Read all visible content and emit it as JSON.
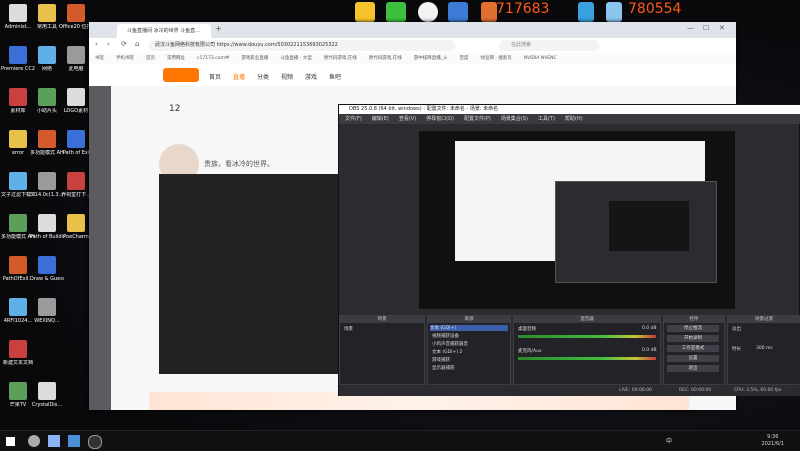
{
  "desktop": {
    "icons": [
      {
        "label": "Administ...",
        "col": 0,
        "row": 0
      },
      {
        "label": "常用工具",
        "col": 1,
        "row": 0
      },
      {
        "label": "Office20 位打印环",
        "col": 2,
        "row": 0
      },
      {
        "label": "Premiere CC2019",
        "col": 0,
        "row": 1
      },
      {
        "label": "网络",
        "col": 1,
        "row": 1
      },
      {
        "label": "此电脑",
        "col": 2,
        "row": 1
      },
      {
        "label": "素材库",
        "col": 0,
        "row": 2
      },
      {
        "label": "小助片头",
        "col": 1,
        "row": 2
      },
      {
        "label": "LOGO素材",
        "col": 2,
        "row": 2
      },
      {
        "label": "error",
        "col": 0,
        "row": 3
      },
      {
        "label": "多功能模式 AHK",
        "col": 1,
        "row": 3
      },
      {
        "label": "Path of Exi",
        "col": 2,
        "row": 3
      },
      {
        "label": "文子过滤下载 地址",
        "col": 0,
        "row": 4
      },
      {
        "label": "3.14.0c(1.3... 翻斯规... 翻",
        "col": 1,
        "row": 4
      },
      {
        "label": "养祠堂打下...",
        "col": 2,
        "row": 4
      },
      {
        "label": "多功能模式 AHK20.19...",
        "col": 0,
        "row": 5
      },
      {
        "label": "Path of Building",
        "col": 1,
        "row": 5
      },
      {
        "label": "PoeCharm",
        "col": 2,
        "row": 5
      },
      {
        "label": "PathOfExil...",
        "col": 0,
        "row": 6
      },
      {
        "label": "Draw & Guess",
        "col": 1,
        "row": 6
      },
      {
        "label": "4RFI1024...",
        "col": 0,
        "row": 7
      },
      {
        "label": "WEXINQ...",
        "col": 1,
        "row": 7
      },
      {
        "label": "新建文本文档",
        "col": 0,
        "row": 8
      },
      {
        "label": "芒果TV",
        "col": 0,
        "row": 9
      },
      {
        "label": "CrystalDis...",
        "col": 1,
        "row": 9
      }
    ],
    "top_numbers": [
      "717683",
      "780554"
    ]
  },
  "browser": {
    "tab_title": "斗鱼直播间 冰冷的世界 斗鱼直...",
    "url": "武汉斗鱼网络科技有限公司 https://www.douyu.com/5030221153693025322",
    "search_placeholder": "在此搜索",
    "bookmarks": [
      "书签",
      "手机书签",
      "首页",
      "常用网址",
      "c17173.com中",
      "游戏影业直播",
      "斗鱼直播 - 大型",
      "原代码游戏,在线",
      "原代码游戏,在线",
      "游中核降直播_斗",
      "百度",
      "绿豆网 · 搜索页",
      "NVIDIA NVENC"
    ],
    "nav": [
      "首页",
      "直播",
      "分类",
      "视频",
      "游戏",
      "鱼吧"
    ],
    "follow_count": "12",
    "banner_text": "贵族，看冰冷的世界。"
  },
  "obs": {
    "title": "OBS 25.0.8 (64 bit, windows) - 配置文件: 未命名 - 场景: 未命名",
    "menu": [
      "文件(F)",
      "编辑(E)",
      "查看(V)",
      "停靠窗口(D)",
      "配置文件(P)",
      "场景集合(S)",
      "工具(T)",
      "帮助(H)"
    ],
    "panels": {
      "scenes": "场景",
      "sources": "来源",
      "mixer": "混音器",
      "transitions": "场景过渡",
      "controls": "控件"
    },
    "scene_items": [
      "场景"
    ],
    "source_items": [
      "文本 (GDI+)",
      "视频捕获设备",
      "小鸡声音捕获器音",
      "文本 (GDI+) 2",
      "游戏捕获",
      "显示器捕获"
    ],
    "mixer_items": [
      {
        "name": "桌面音频",
        "db": "0.0 dB"
      },
      {
        "name": "麦克风/Aux",
        "db": "0.0 dB"
      }
    ],
    "transition": {
      "name": "淡出",
      "duration_label": "时长",
      "duration": "300 ms"
    },
    "controls": [
      "停止推流",
      "开始录制",
      "工作室模式",
      "设置",
      "退出"
    ],
    "status": {
      "live": "LIVE: 00:00:00",
      "rec": "REC: 00:00:00",
      "cpu": "CPU: 3.5%, 60.00 fps"
    }
  },
  "taskbar": {
    "time": "9:36",
    "date": "2021/6/1",
    "ime": "中"
  },
  "colors": {
    "accent_orange": "#ff5a1a",
    "obs_bg": "#2b2b30",
    "douyu_orange": "#ff7700"
  }
}
